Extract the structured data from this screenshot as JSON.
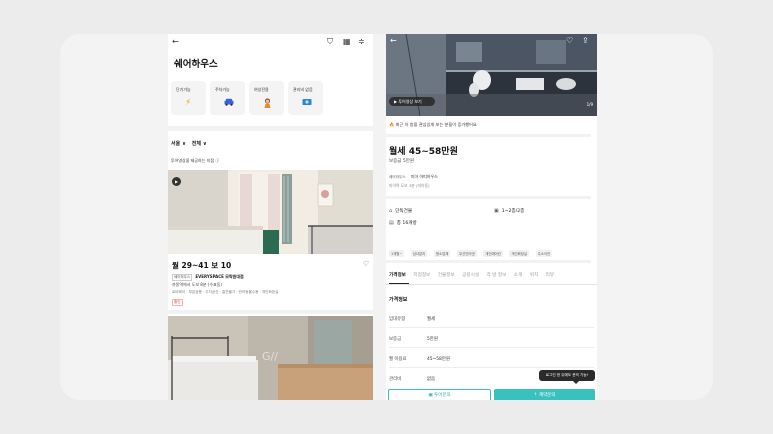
{
  "left_screen": {
    "page_title": "쉐어하우스",
    "categories": [
      {
        "label": "단기가능",
        "icon": "lightning-icon"
      },
      {
        "label": "주차가능",
        "icon": "car-icon"
      },
      {
        "label": "여성전용",
        "icon": "woman-icon"
      },
      {
        "label": "관리비 없음",
        "icon": "money-icon"
      }
    ],
    "filters": {
      "region": "서울 ∨",
      "type": "전체 ∨"
    },
    "video_note": "투어영상을 제공하는 지점 ⓘ",
    "listing": {
      "price": "월 29~41  보 10",
      "type_tag": "쉐어하우스",
      "name": "EVERYSPACE 모락원대점",
      "distance": "까몽역에서 도보 8분 (수표동)",
      "features": "로비레이 · 부분공용 · 주차공간 · 흡연불가 · 반려동물수용 · 개인화장실",
      "badge": "할인"
    }
  },
  "right_screen": {
    "hero": {
      "video_button": "▶ 투어영상 보기",
      "page_indicator": "1/9"
    },
    "notice": "최근 이 방을 관심있게 보는 분들이 증가했어요",
    "price": "월세 45~58만원",
    "deposit": "보증금 5만원",
    "type_tag": "쉐어하우스",
    "name": "미아 아띠하우스",
    "distance": "미아역 도보 3분 (미아동)",
    "facts": [
      {
        "icon": "building-icon",
        "text": "단독건물"
      },
      {
        "icon": "door-icon",
        "text": "1~2층/2층"
      },
      {
        "icon": "layers-icon",
        "text": "총 16개방"
      }
    ],
    "options": [
      "1개월~",
      "남녀분리",
      "청소업체",
      "무선인터넷",
      "개인에어컨",
      "개인화장실",
      "주소이전"
    ],
    "tabs": [
      "가격정보",
      "지점정보",
      "건물정보",
      "공용시설",
      "각 방 정보",
      "소개",
      "위치",
      "리뷰"
    ],
    "price_section_title": "가격정보",
    "price_rows": [
      {
        "key": "임대유형",
        "value": "월세"
      },
      {
        "key": "보증금",
        "value": "5만원"
      },
      {
        "key": "월 이용료",
        "value": "45~58만원"
      },
      {
        "key": "관리비",
        "value": "없음"
      }
    ],
    "tooltip": "로그인 한 뒤에도 문의 가능!",
    "button_tour": "투어문의",
    "button_contact": "계약문의"
  },
  "colors": {
    "accent": "#39c2bd",
    "badge_red": "#e0453a",
    "card_bg": "#f3f3f3"
  }
}
